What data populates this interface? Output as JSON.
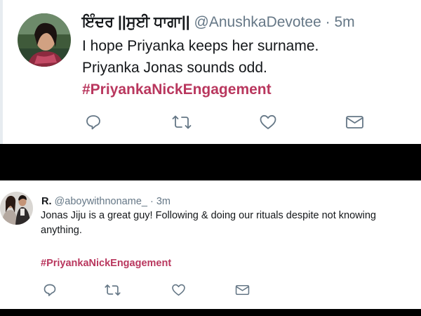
{
  "tweets": [
    {
      "display_name": "ਇੰਦਰ ||ਸੁਈ ਧਾਗਾ||",
      "handle": "@AnushkaDevotee",
      "time": "· 5m",
      "line1": "I hope Priyanka keeps her surname.",
      "line2": "Priyanka Jonas sounds odd.",
      "hashtag": "#PriyankaNickEngagement"
    },
    {
      "display_name": "R.",
      "handle": "@aboywithnoname_",
      "time": "· 3m",
      "line1": "Jonas Jiju is a great guy! Following & doing our rituals despite not knowing",
      "line2": "anything.",
      "hashtag": "#PriyankaNickEngagement"
    }
  ],
  "icons": {
    "reply": "reply-icon",
    "retweet": "retweet-icon",
    "like": "heart-icon",
    "dm": "envelope-icon"
  },
  "colors": {
    "hashtag": "#b9375e",
    "icon": "#657786",
    "divider": "#000000"
  }
}
